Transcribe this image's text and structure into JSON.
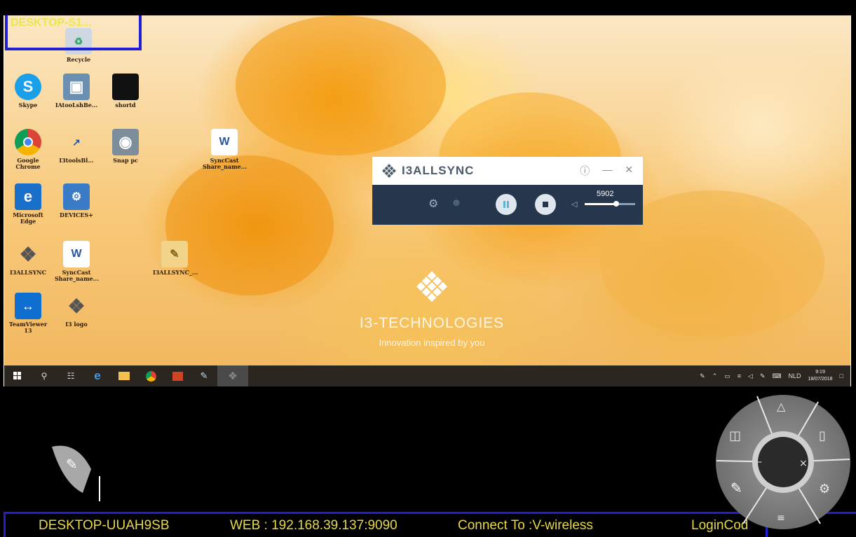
{
  "remote_machine": {
    "name_partial": "DESKTOP-S1..."
  },
  "desktop_icons": [
    {
      "id": "recycle",
      "label": "Recycle"
    },
    {
      "id": "skype",
      "label": "Skype"
    },
    {
      "id": "shortcut1",
      "label": "IAtooLshBe..."
    },
    {
      "id": "shortcut2",
      "label": "shortd"
    },
    {
      "id": "chrome",
      "label": "Google\nChrome"
    },
    {
      "id": "shortcut3",
      "label": "I3toolsBl..."
    },
    {
      "id": "snap",
      "label": "Snap pc"
    },
    {
      "id": "doc1",
      "label": "SyncCast\nShare_name..."
    },
    {
      "id": "edge",
      "label": "Microsoft\nEdge"
    },
    {
      "id": "devices",
      "label": "DEVICES+"
    },
    {
      "id": "i3allsync",
      "label": "I3ALLSYNC"
    },
    {
      "id": "doc2",
      "label": "SyncCast\nShare_name..."
    },
    {
      "id": "folder",
      "label": "I3ALLSYNC_..."
    },
    {
      "id": "teamviewer",
      "label": "TeamViewer\n13"
    },
    {
      "id": "i3logo",
      "label": "I3 logo"
    }
  ],
  "sync_widget": {
    "title": "I3ALLSYNC",
    "volume_value": "5902",
    "volume_level": 0.62
  },
  "brand": {
    "name": "I3-TECHNOLOGIES",
    "tagline": "Innovation inspired by you"
  },
  "taskbar": {
    "lang": "NLD",
    "time": "9:19",
    "date": "18/07/2018"
  },
  "info_bar": {
    "device": "DESKTOP-UUAH9SB",
    "web": "WEB : 192.168.39.137:9090",
    "connect": "Connect To :V-wireless",
    "login": "LoginCod"
  },
  "colors": {
    "info_text": "#e6d94a",
    "frame_border": "#1f1fd4",
    "widget_dark": "#25364d"
  }
}
